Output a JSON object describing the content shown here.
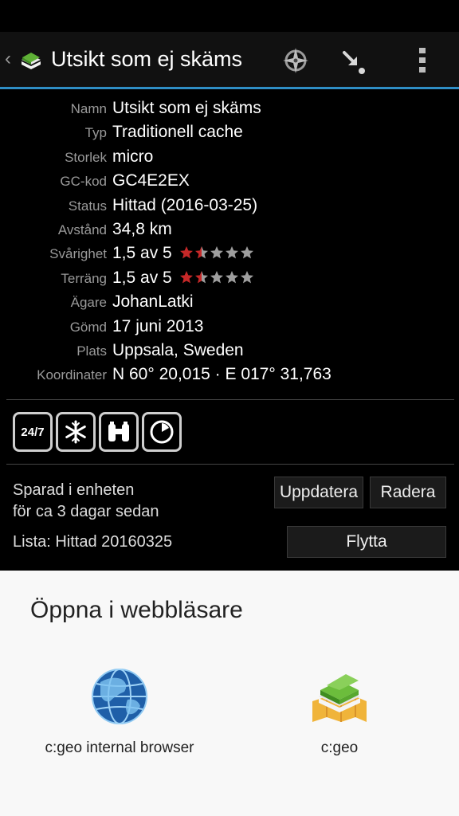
{
  "action_bar": {
    "title": "Utsikt som ej skäms",
    "back_icon": "chevron-left-icon",
    "icons": [
      "compass-icon",
      "navigate-arrow-icon",
      "overflow-menu-icon"
    ]
  },
  "details": [
    {
      "label": "Namn",
      "value": "Utsikt som ej skäms"
    },
    {
      "label": "Typ",
      "value": "Traditionell cache"
    },
    {
      "label": "Storlek",
      "value": "micro"
    },
    {
      "label": "GC-kod",
      "value": "GC4E2EX"
    },
    {
      "label": "Status",
      "value": "Hittad (2016-03-25)"
    },
    {
      "label": "Avstånd",
      "value": "34,8 km"
    },
    {
      "label": "Svårighet",
      "value": "1,5 av 5",
      "rating": 1.5
    },
    {
      "label": "Terräng",
      "value": "1,5 av 5",
      "rating": 1.5
    },
    {
      "label": "Ägare",
      "value": "JohanLatki"
    },
    {
      "label": "Gömd",
      "value": "17 juni 2013"
    },
    {
      "label": "Plats",
      "value": "Uppsala, Sweden"
    },
    {
      "label": "Koordinater",
      "value": "N 60° 20,015 · E 017° 31,763"
    }
  ],
  "attributes": {
    "always_text": "24/7",
    "icons": [
      "available-24-7-icon",
      "snowflake-icon",
      "binoculars-icon",
      "clock-icon"
    ]
  },
  "storage": {
    "saved_line1": "Sparad i enheten",
    "saved_line2": "för ca 3 dagar sedan",
    "update_label": "Uppdatera",
    "delete_label": "Radera",
    "list_text": "Lista: Hittad 20160325",
    "move_label": "Flytta"
  },
  "sheet": {
    "title": "Öppna i webbläsare",
    "apps": [
      {
        "label": "c:geo internal browser",
        "icon": "globe-icon"
      },
      {
        "label": "c:geo",
        "icon": "cgeo-app-icon"
      }
    ]
  },
  "colors": {
    "accent": "#2f8ec6",
    "star_filled": "#c62828",
    "star_empty": "#9e9e9e"
  }
}
